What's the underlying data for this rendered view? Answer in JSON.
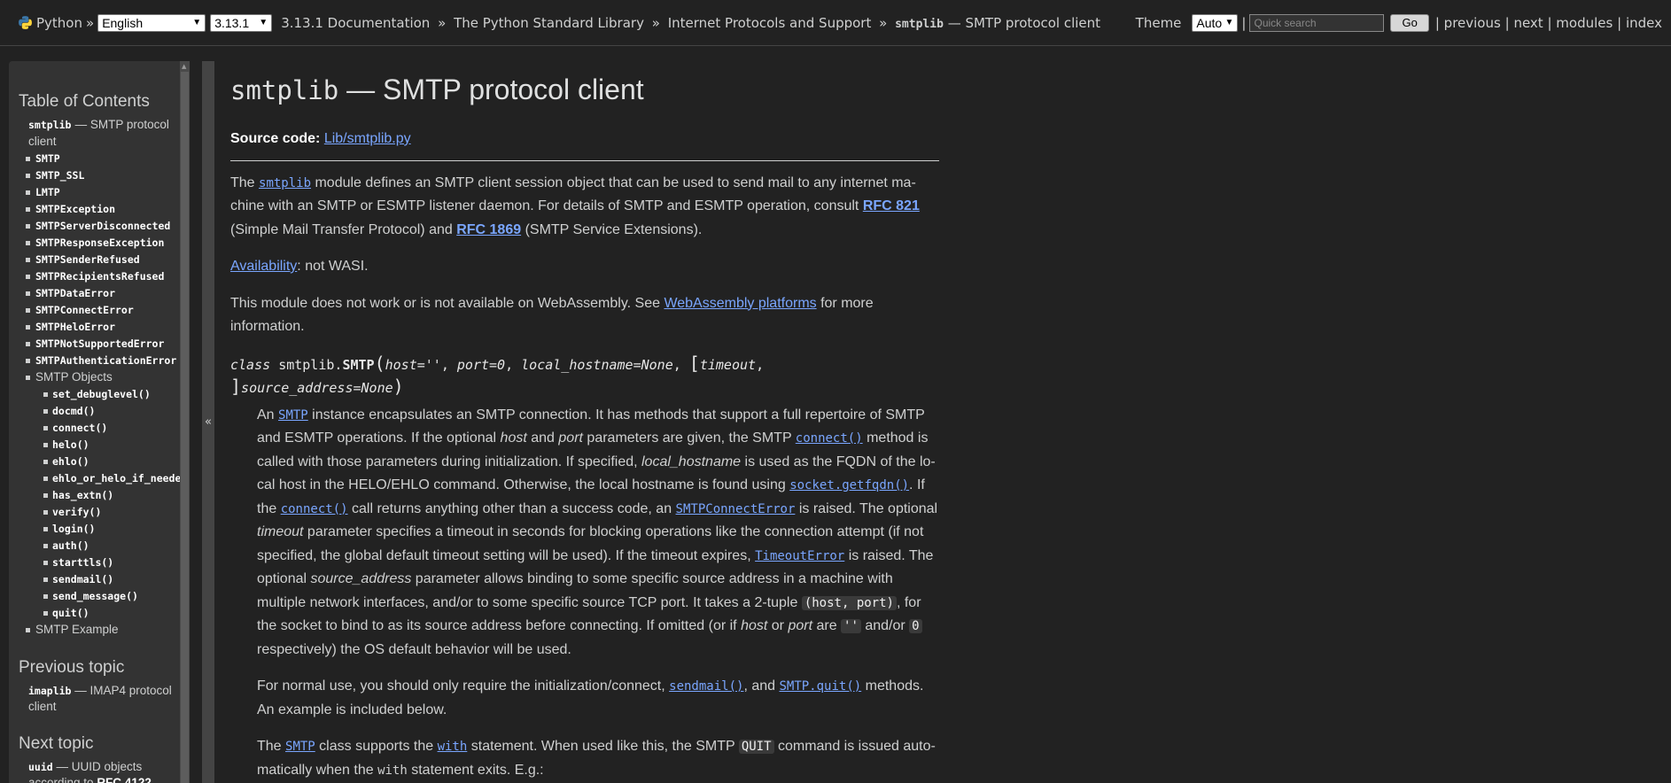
{
  "topbar": {
    "python_label": "Python",
    "sep": "»",
    "language": "English",
    "version": "3.13.1",
    "breadcrumbs": [
      "3.13.1 Documentation",
      "The Python Standard Library",
      "Internet Protocols and Support"
    ],
    "current_code": "smtplib",
    "current_text": "— SMTP protocol client",
    "theme_label": "Theme",
    "theme_value": "Auto",
    "pipe": "|",
    "search_placeholder": "Quick search",
    "go_label": "Go",
    "links": [
      "previous",
      "next",
      "modules",
      "index"
    ]
  },
  "sidebar": {
    "toc_title": "Table of Contents",
    "collapse_icon": "«",
    "toc_top_code": "smtplib",
    "toc_top_text": "— SMTP protocol client",
    "classes": [
      "SMTP",
      "SMTP_SSL",
      "LMTP",
      "SMTPException",
      "SMTPServerDisconnected",
      "SMTPResponseException",
      "SMTPSenderRefused",
      "SMTPRecipientsRefused",
      "SMTPDataError",
      "SMTPConnectError",
      "SMTPHeloError",
      "SMTPNotSupportedError",
      "SMTPAuthenticationError"
    ],
    "smtp_objects": "SMTP Objects",
    "methods": [
      "set_debuglevel()",
      "docmd()",
      "connect()",
      "helo()",
      "ehlo()",
      "ehlo_or_helo_if_needed()",
      "has_extn()",
      "verify()",
      "login()",
      "auth()",
      "starttls()",
      "sendmail()",
      "send_message()",
      "quit()"
    ],
    "smtp_example": "SMTP Example",
    "prev_title": "Previous topic",
    "prev_code": "imaplib",
    "prev_text": "— IMAP4 protocol client",
    "next_title": "Next topic",
    "next_code": "uuid",
    "next_text": "— UUID objects according to",
    "next_rfc": "RFC 4122"
  },
  "main": {
    "title_code": "smtplib",
    "title_text": "— SMTP protocol client",
    "source_label": "Source code:",
    "source_link": "Lib/smtplib.py",
    "p1": {
      "t1": "The ",
      "c1": "smtplib",
      "t2": " module defines an SMTP client session object that can be used to send mail to any internet ma- chine with an SMTP or ESMTP listener daemon. For details of SMTP and ESMTP operation, consult ",
      "rfc1": "RFC 821",
      "t3": " (Simple Mail Transfer Protocol) and ",
      "rfc2": "RFC 1869",
      "t4": " (SMTP Service Extensions)."
    },
    "availability_link": "Availability",
    "availability_text": ": not WASI.",
    "wasm": {
      "t1": "This module does not work or is not available on WebAssembly. See ",
      "link": "WebAssembly platforms",
      "t2": " for more information."
    },
    "sig": {
      "kw": "class",
      "mod": "smtplib.",
      "name": "SMTP",
      "open": "(",
      "p1": "host=''",
      "c": ", ",
      "p2": "port=0",
      "p3": "local_hostname=None",
      "lb": "[",
      "p4": "timeout",
      "rb": "]",
      "p5": "source_address=None",
      "close": ")"
    },
    "d1": {
      "a": "An ",
      "smtp": "SMTP",
      "b": " instance encapsulates an SMTP connection. It has methods that support a full repertoire of SMTP and ESMTP operations. If the optional ",
      "host": "host",
      "c": " and ",
      "port": "port",
      "d": " parameters are given, the SMTP ",
      "connect": "connect()",
      "e": " method is called with those parameters during initialization. If specified, ",
      "lh": "local_hostname",
      "f": " is used as the FQDN of the lo- cal host in the HELO/EHLO command. Otherwise, the local hostname is found using ",
      "getfqdn": "socket.getfqdn()",
      "g": ". If the ",
      "connect2": "connect()",
      "h": " call returns anything other than a success code, an ",
      "err": "SMTPConnectError",
      "i": " is raised. The optional ",
      "timeout": "timeout",
      "j": " parameter specifies a timeout in seconds for blocking operations like the connection attempt (if not specified, the global default timeout setting will be used). If the timeout expires, ",
      "terr": "TimeoutError",
      "k": " is raised. The optional ",
      "sa": "source_address",
      "l": " parameter allows binding to some specific source address in a machine with multiple network interfaces, and/or to some specific source TCP port. It takes a 2-tuple ",
      "tuple": "(host, port)",
      "m": ", for the socket to bind to as its source address before connecting. If omitted (or if ",
      "host2": "host",
      "n": " or ",
      "port2": "port",
      "o": " are ",
      "empty": "''",
      "p": " and/or ",
      "zero": "0",
      "q": " respectively) the OS default behavior will be used."
    },
    "d2": {
      "a": "For normal use, you should only require the initialization/connect, ",
      "sendmail": "sendmail()",
      "b": ", and ",
      "quit": "SMTP.quit()",
      "c": " methods. An example is included below."
    },
    "d3": {
      "a": "The ",
      "smtp": "SMTP",
      "b": " class supports the ",
      "with": "with",
      "c": " statement. When used like this, the SMTP ",
      "quit": "QUIT",
      "d": " command is issued auto- matically when the ",
      "with2": "with",
      "e": " statement exits. E.g.:"
    }
  }
}
